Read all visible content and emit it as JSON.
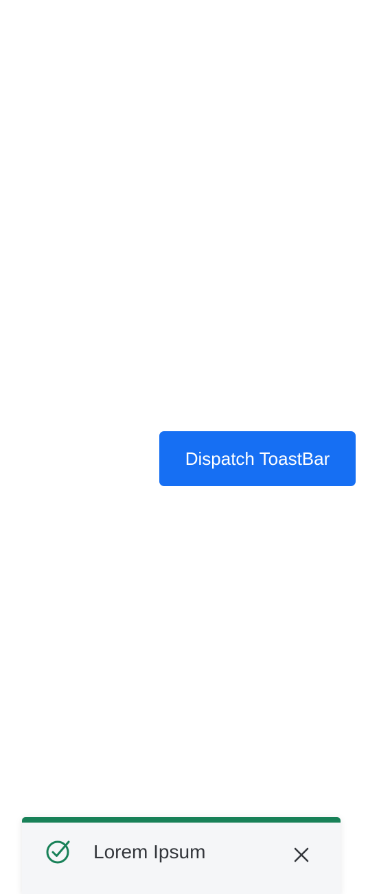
{
  "dispatch_button": {
    "label": "Dispatch ToastBar"
  },
  "toast": {
    "message": "Lorem Ipsum",
    "icon": "check-circle-icon",
    "close_icon": "close-icon"
  },
  "colors": {
    "button_background": "#166ff3",
    "success_accent": "#188158",
    "toast_background": "#f5f6f8",
    "close_icon": "#33363b"
  }
}
